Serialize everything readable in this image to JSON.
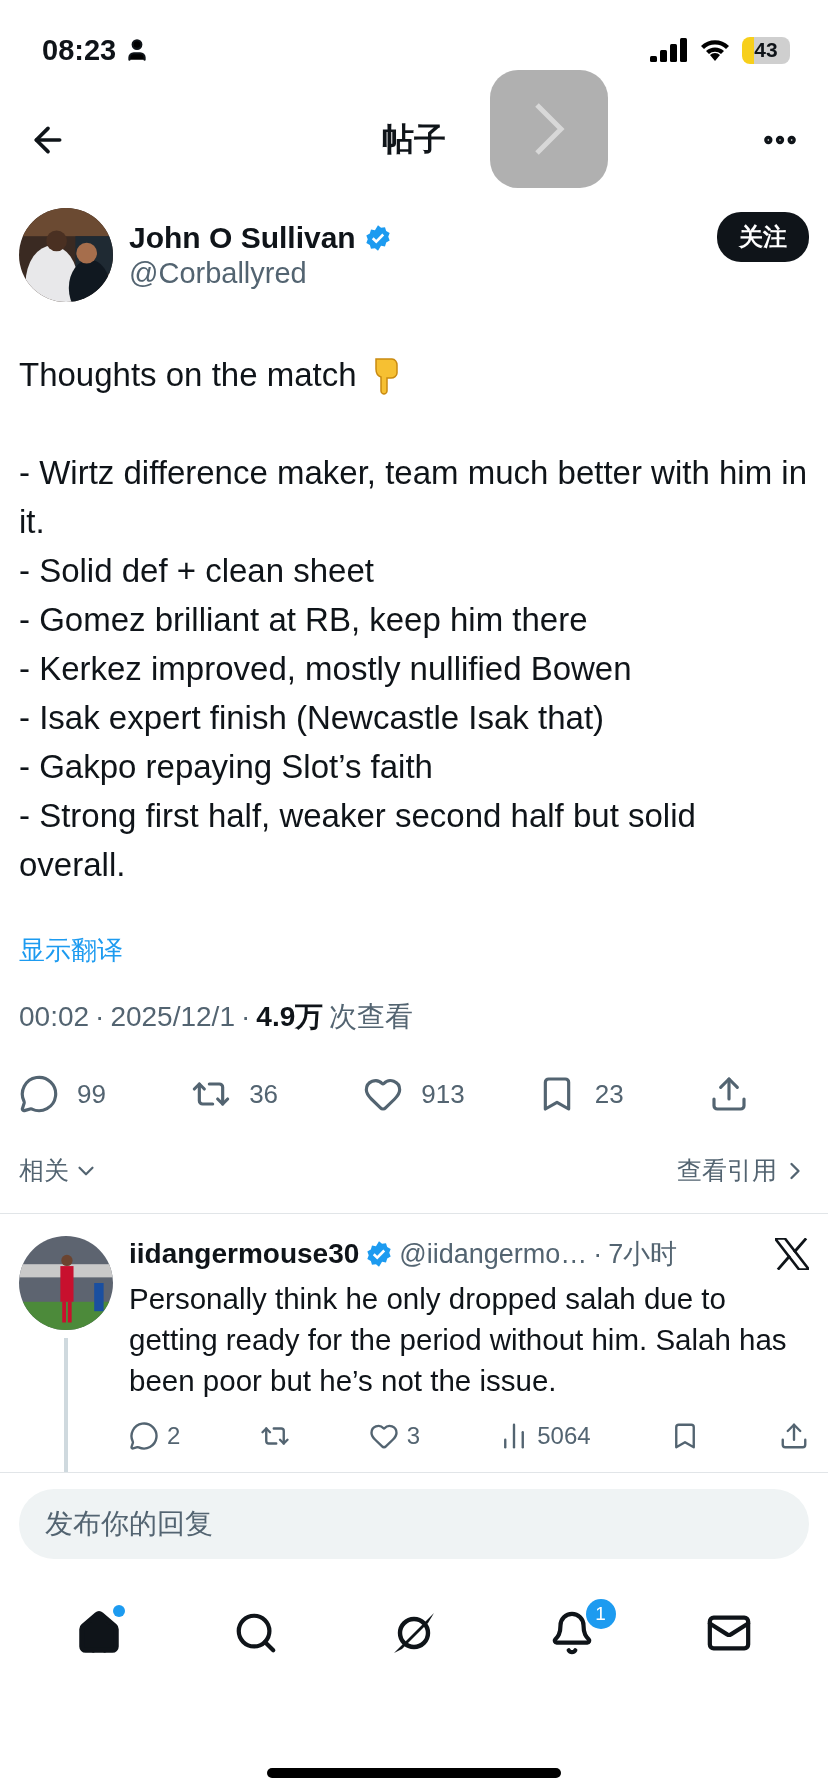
{
  "status_bar": {
    "time": "08:23",
    "battery": "43",
    "low_power": true
  },
  "header": {
    "title": "帖子"
  },
  "post": {
    "author": {
      "name": "John O Sullivan",
      "handle": "@Corballyred",
      "verified": true
    },
    "follow_label": "关注",
    "intro": "Thoughts on the match",
    "lines": [
      "- Wirtz difference maker, team much better with him in it.",
      "- Solid def + clean sheet",
      "- Gomez brilliant at RB, keep him there",
      "- Kerkez improved, mostly nullified Bowen",
      "- Isak expert finish (Newcastle Isak that)",
      "- Gakpo repaying Slot’s faith",
      "- Strong first half, weaker second half but solid overall."
    ],
    "translate": "显示翻译",
    "meta": {
      "time": "00:02",
      "separator": "·",
      "date": "2025/12/1",
      "views": "4.9万",
      "views_label": "次查看"
    },
    "actions": [
      {
        "kind": "reply",
        "count": "99"
      },
      {
        "kind": "repost",
        "count": "36"
      },
      {
        "kind": "like",
        "count": "913"
      },
      {
        "kind": "bookmark",
        "count": "23"
      },
      {
        "kind": "share"
      }
    ]
  },
  "related": {
    "label": "相关",
    "quotes": "查看引用"
  },
  "replies": [
    {
      "name": "iidangermouse30",
      "verified": true,
      "handle": "@iidangermo…",
      "separator": "·",
      "time": "7小时",
      "text": "Personally think he only dropped salah due to getting ready for the period without him. Salah has been poor but he’s not the issue.",
      "actions": [
        {
          "kind": "reply",
          "count": "2"
        },
        {
          "kind": "repost"
        },
        {
          "kind": "like",
          "count": "3"
        },
        {
          "kind": "views",
          "count": "5064"
        },
        {
          "kind": "bookmark"
        },
        {
          "kind": "share"
        }
      ]
    }
  ],
  "composer": {
    "placeholder": "发布你的回复"
  },
  "tabs": [
    {
      "kind": "home",
      "selected": true,
      "has_new": true
    },
    {
      "kind": "search",
      "selected": false
    },
    {
      "kind": "grok",
      "selected": false
    },
    {
      "kind": "notifications",
      "selected": false,
      "badge": "1"
    },
    {
      "kind": "messages",
      "selected": false
    }
  ]
}
